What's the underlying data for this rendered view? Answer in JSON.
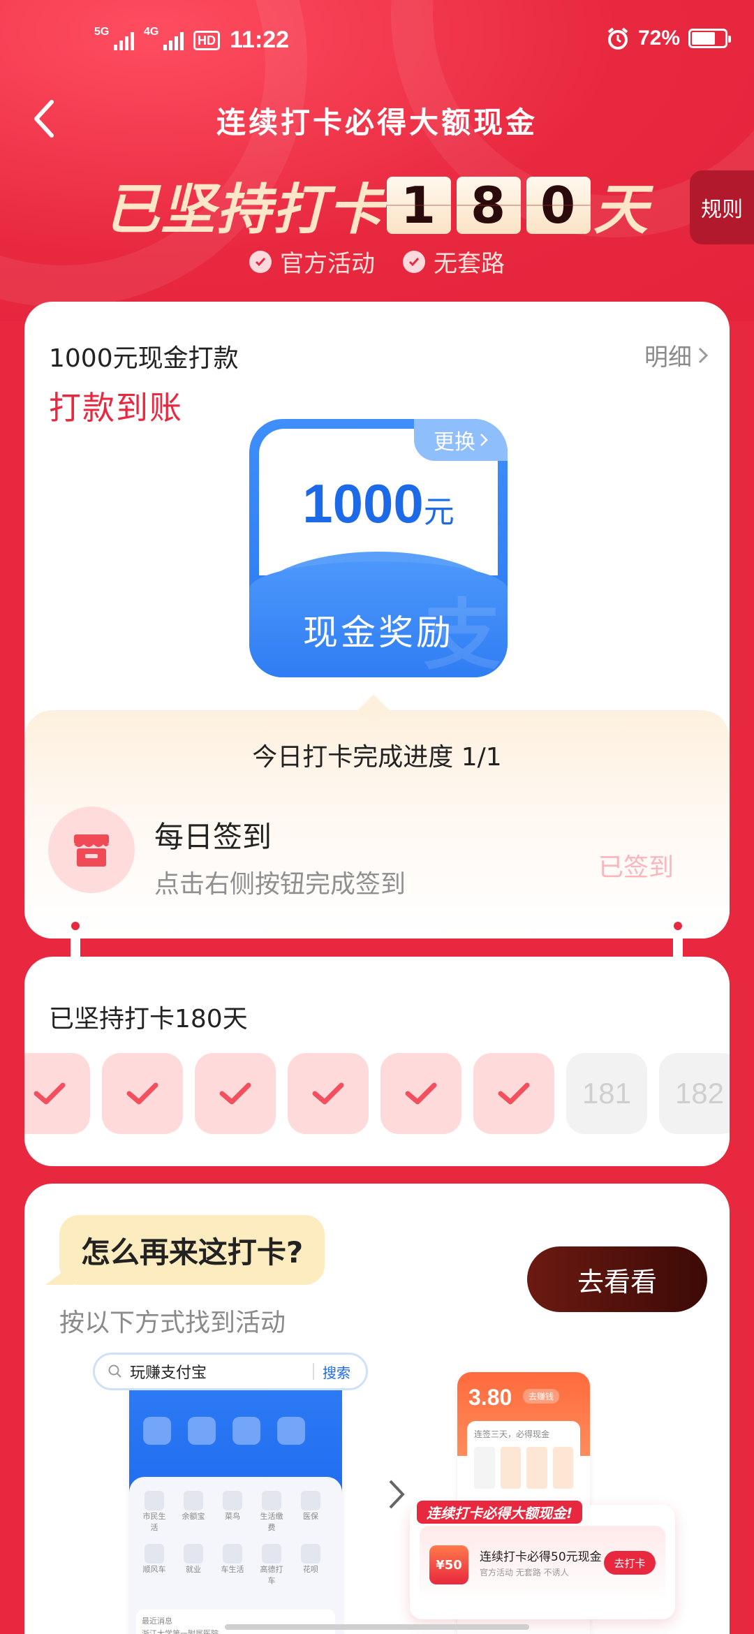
{
  "status_bar": {
    "network1": "5G",
    "network2": "4G",
    "hd": "HD",
    "time": "11:22",
    "battery": "72%",
    "battery_level": 0.72
  },
  "header": {
    "title": "连续打卡必得大额现金",
    "streak_prefix": "已坚持打卡",
    "streak_digits": [
      "1",
      "8",
      "0"
    ],
    "streak_suffix": "天",
    "badges": [
      "官方活动",
      "无套路"
    ],
    "rules": "规则"
  },
  "reward_card": {
    "title": "1000元现金打款",
    "detail": "明细",
    "paid_status": "打款到账",
    "swap": "更换",
    "amount": "1000",
    "unit": "元",
    "label": "现金奖励",
    "progress": "今日打卡完成进度 1/1",
    "task_title": "每日签到",
    "task_sub": "点击右侧按钮完成签到",
    "task_status": "已签到"
  },
  "streak_card": {
    "title": "已坚持打卡180天",
    "future_days": [
      "181",
      "182"
    ]
  },
  "howto_card": {
    "question": "怎么再来这打卡?",
    "sub": "按以下方式找到活动",
    "go_button": "去看看",
    "search_text": "玩赚支付宝",
    "search_button": "搜索",
    "grid_labels": [
      "市民生活",
      "余额宝",
      "菜鸟",
      "生活缴费",
      "医保",
      "顺风车",
      "就业",
      "车生活",
      "高德打车",
      "花呗"
    ],
    "news_line1": "最近消息",
    "news_line2": "浙江大学第一附属医院",
    "shot_price": "3.80",
    "shot_tag": "去赚钱",
    "shot_box_text": "连签三天，必得现金",
    "popup_ribbon": "连续打卡必得大额现金!",
    "popup_money": "¥50",
    "popup_title": "连续打卡必得50元现金",
    "popup_sub": "官方活动  无套路  不诱人",
    "popup_button": "去打卡"
  },
  "colors": {
    "primary_red": "#e8283f",
    "reward_blue": "#2a78f2",
    "button_dark": "#4a0f08"
  }
}
